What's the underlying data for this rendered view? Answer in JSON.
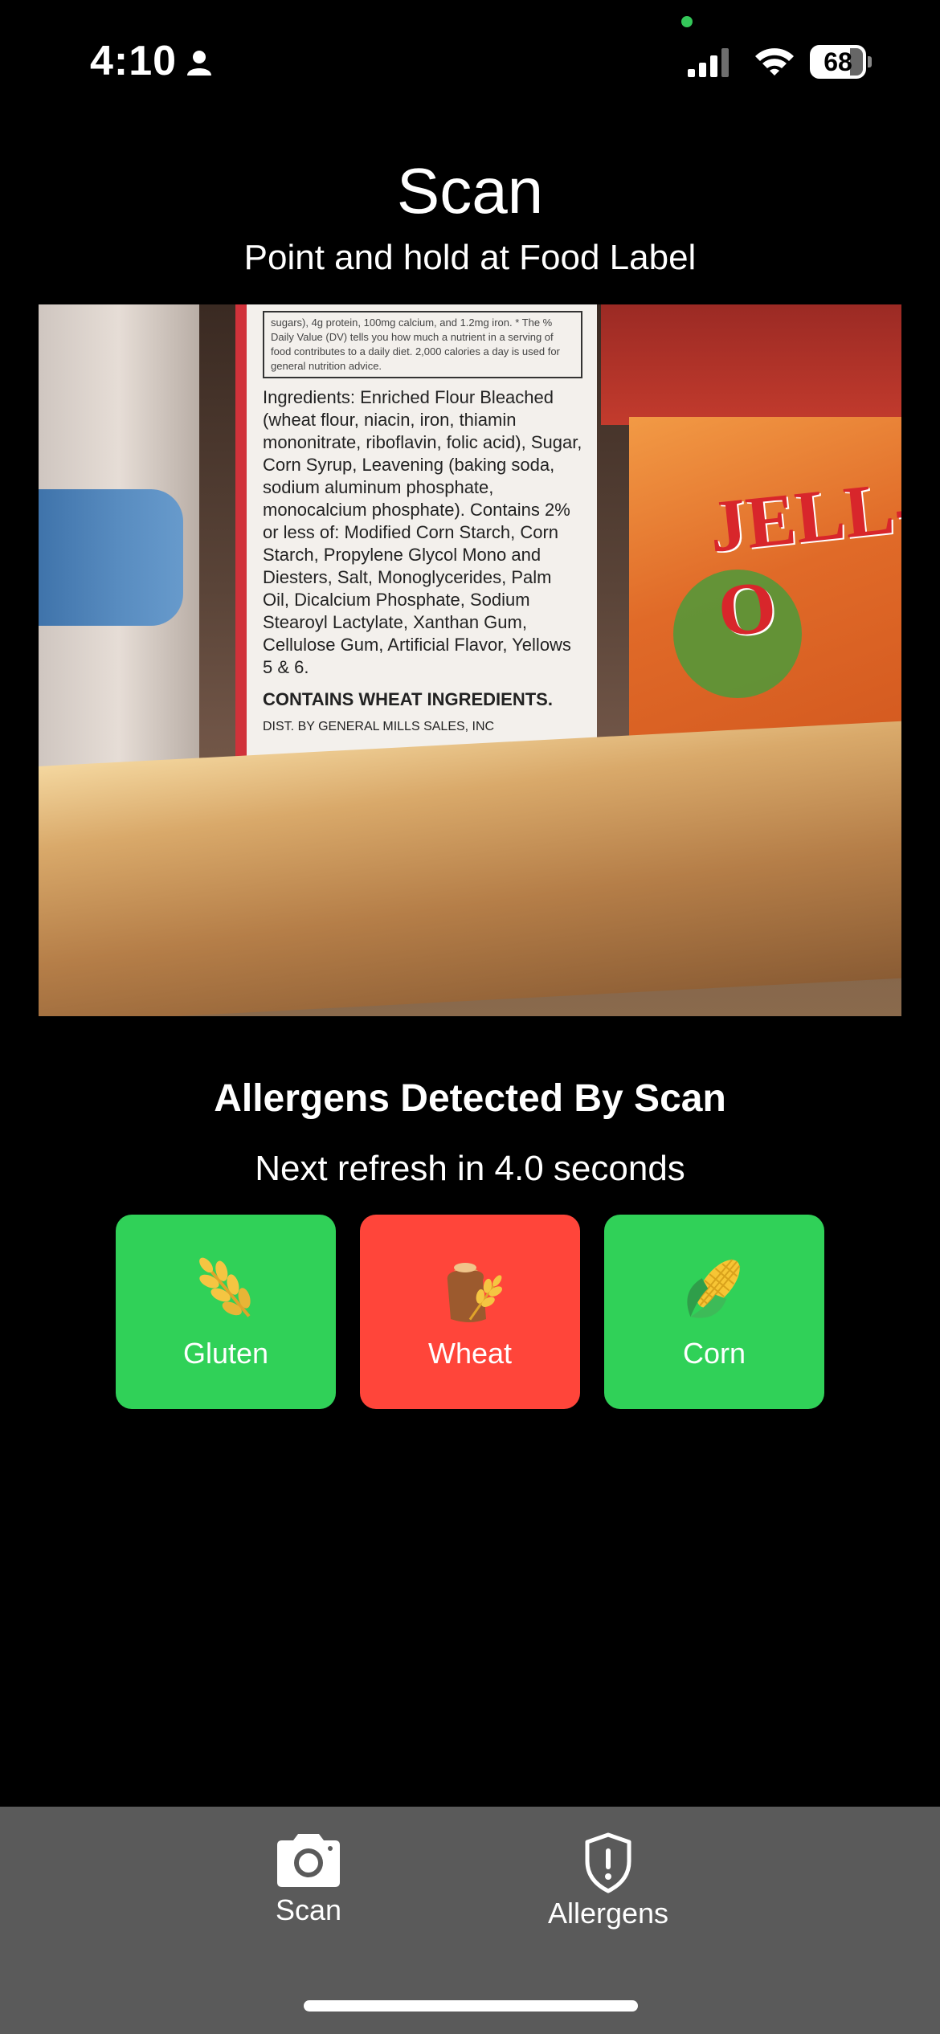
{
  "status_bar": {
    "time": "4:10",
    "battery": "68"
  },
  "header": {
    "title": "Scan",
    "subtitle": "Point and hold at Food Label"
  },
  "camera_preview": {
    "label_text": {
      "top_lines": "sugars), 4g protein, 100mg calcium, and 1.2mg iron. * The % Daily Value (DV) tells you how much a nutrient in a serving of food contributes to a daily diet. 2,000 calories a day is used for general nutrition advice.",
      "ingredients": "Ingredients: Enriched Flour Bleached (wheat flour, niacin, iron, thiamin mononitrate, riboflavin, folic acid), Sugar, Corn Syrup, Leavening (baking soda, sodium aluminum phosphate, monocalcium phosphate). Contains 2% or less of: Modified Corn Starch, Corn Starch, Propylene Glycol Mono and Diesters, Salt, Monoglycerides, Palm Oil, Dicalcium Phosphate, Sodium Stearoyl Lactylate, Xanthan Gum, Cellulose Gum, Artificial Flavor, Yellows 5 & 6.",
      "contains": "CONTAINS WHEAT INGREDIENTS.",
      "dist": "DIST. BY GENERAL MILLS SALES, INC"
    },
    "box_brand": "JELL-O"
  },
  "allergens": {
    "title": "Allergens Detected By Scan",
    "refresh_text": "Next refresh in 4.0 seconds",
    "items": [
      {
        "label": "Gluten",
        "icon": "wheat-ear-icon",
        "status_color": "#30d158"
      },
      {
        "label": "Wheat",
        "icon": "wheat-bag-icon",
        "status_color": "#ff453a"
      },
      {
        "label": "Corn",
        "icon": "corn-icon",
        "status_color": "#30d158"
      }
    ]
  },
  "tab_bar": {
    "tabs": [
      {
        "label": "Scan",
        "icon": "camera-icon"
      },
      {
        "label": "Allergens",
        "icon": "shield-exclamation-icon"
      }
    ]
  }
}
